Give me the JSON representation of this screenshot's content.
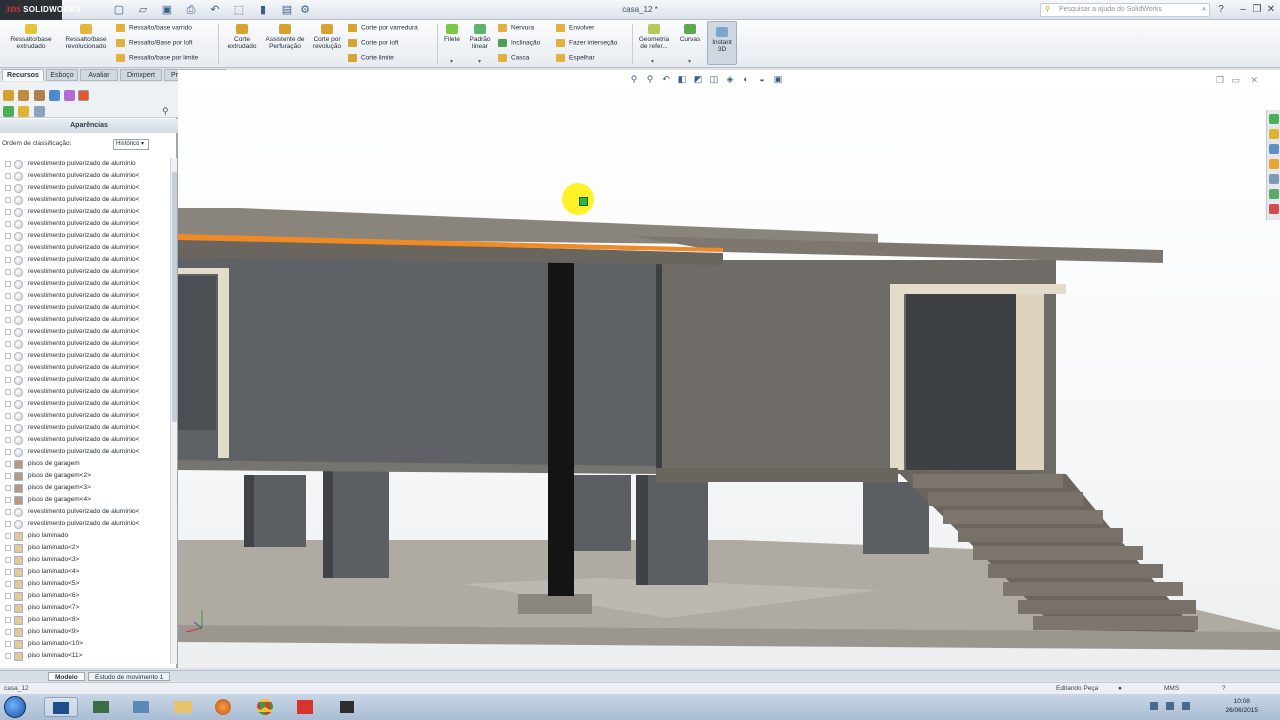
{
  "title_bar": {
    "logo_text": "SOLIDWORKS",
    "logo_prefix": "3DS",
    "document_title": "casa_12 *",
    "search_placeholder": "Pesquisar a ajuda do SolidWorks",
    "search_icon": "magnifier-icon",
    "help_icon": "help-icon"
  },
  "ribbon": {
    "big_buttons": [
      {
        "label": "Ressalto/base extrudado"
      },
      {
        "label": "Ressalto/base revolucionado"
      },
      {
        "label": "Corte extrudado"
      },
      {
        "label": "Assistente de Perfuração"
      },
      {
        "label": "Corte por revolução"
      },
      {
        "label": "Filete"
      },
      {
        "label": "Padrão linear"
      },
      {
        "label": "Geometria de refer..."
      },
      {
        "label": "Curvas"
      },
      {
        "label": "Instant 3D"
      }
    ],
    "small_buttons": [
      {
        "label": "Ressalto/base varrido"
      },
      {
        "label": "Ressalto/Base por loft"
      },
      {
        "label": "Ressalto/base por limite"
      },
      {
        "label": "Corte por varredura"
      },
      {
        "label": "Corte por loft"
      },
      {
        "label": "Corte limite"
      },
      {
        "label": "Nervura"
      },
      {
        "label": "Inclinação"
      },
      {
        "label": "Casca"
      },
      {
        "label": "Envolver"
      },
      {
        "label": "Fazer interseção"
      },
      {
        "label": "Espelhar"
      }
    ],
    "accent": "#f2b705"
  },
  "command_tabs": [
    {
      "label": "Recursos",
      "active": true
    },
    {
      "label": "Esboço",
      "active": false
    },
    {
      "label": "Avaliar",
      "active": false
    },
    {
      "label": "Dimxpert",
      "active": false
    },
    {
      "label": "Produtos Office",
      "active": false
    }
  ],
  "left_panel": {
    "title": "Aparências",
    "sort_label": "Ordem de classificação:",
    "sort_value": "Histórico",
    "items": [
      "revestimento pulverizado de alumínio",
      "revestimento pulverizado de alumínio<",
      "revestimento pulverizado de alumínio<",
      "revestimento pulverizado de alumínio<",
      "revestimento pulverizado de alumínio<",
      "revestimento pulverizado de alumínio<",
      "revestimento pulverizado de alumínio<",
      "revestimento pulverizado de alumínio<",
      "revestimento pulverizado de alumínio<",
      "revestimento pulverizado de alumínio<",
      "revestimento pulverizado de alumínio<",
      "revestimento pulverizado de alumínio<",
      "revestimento pulverizado de alumínio<",
      "revestimento pulverizado de alumínio<",
      "revestimento pulverizado de alumínio<",
      "revestimento pulverizado de alumínio<",
      "revestimento pulverizado de alumínio<",
      "revestimento pulverizado de alumínio<",
      "revestimento pulverizado de alumínio<",
      "revestimento pulverizado de alumínio<",
      "revestimento pulverizado de alumínio<",
      "revestimento pulverizado de alumínio<",
      "revestimento pulverizado de alumínio<",
      "revestimento pulverizado de alumínio<",
      "revestimento pulverizado de alumínio<",
      "pisos de garagem",
      "pisos de garagem<2>",
      "pisos de garagem<3>",
      "pisos de garagem<4>",
      "revestimento pulverizado de alumínio<",
      "revestimento pulverizado de alumínio<",
      "piso laminado",
      "piso laminado<2>",
      "piso laminado<3>",
      "piso laminado<4>",
      "piso laminado<5>",
      "piso laminado<6>",
      "piso laminado<7>",
      "piso laminado<8>",
      "piso laminado<9>",
      "piso laminado<10>",
      "piso laminado<11>"
    ],
    "swatch_colors": {
      "metal": "#d9dde2",
      "garage": "#b39a86",
      "laminate": "#e6c99a"
    }
  },
  "bottom_tabs": [
    {
      "label": "Modelo",
      "active": true
    },
    {
      "label": "Estudo de movimento 1",
      "active": false
    }
  ],
  "status_bar": {
    "filename": "casa_12",
    "mode": "Editando Peça",
    "units": "MMS"
  },
  "taskbar": {
    "time": "10:08",
    "date": "26/06/2015"
  },
  "viewport_colors": {
    "roof": "#8a857c",
    "wall_gray": "#5e6165",
    "wall_dark": "#4b4e52",
    "wood_wall": "#6f6b66",
    "trim": "#e4dccb",
    "floor": "#b0aba2",
    "stairs": "#6b655e",
    "highlight": "#f08a24"
  }
}
